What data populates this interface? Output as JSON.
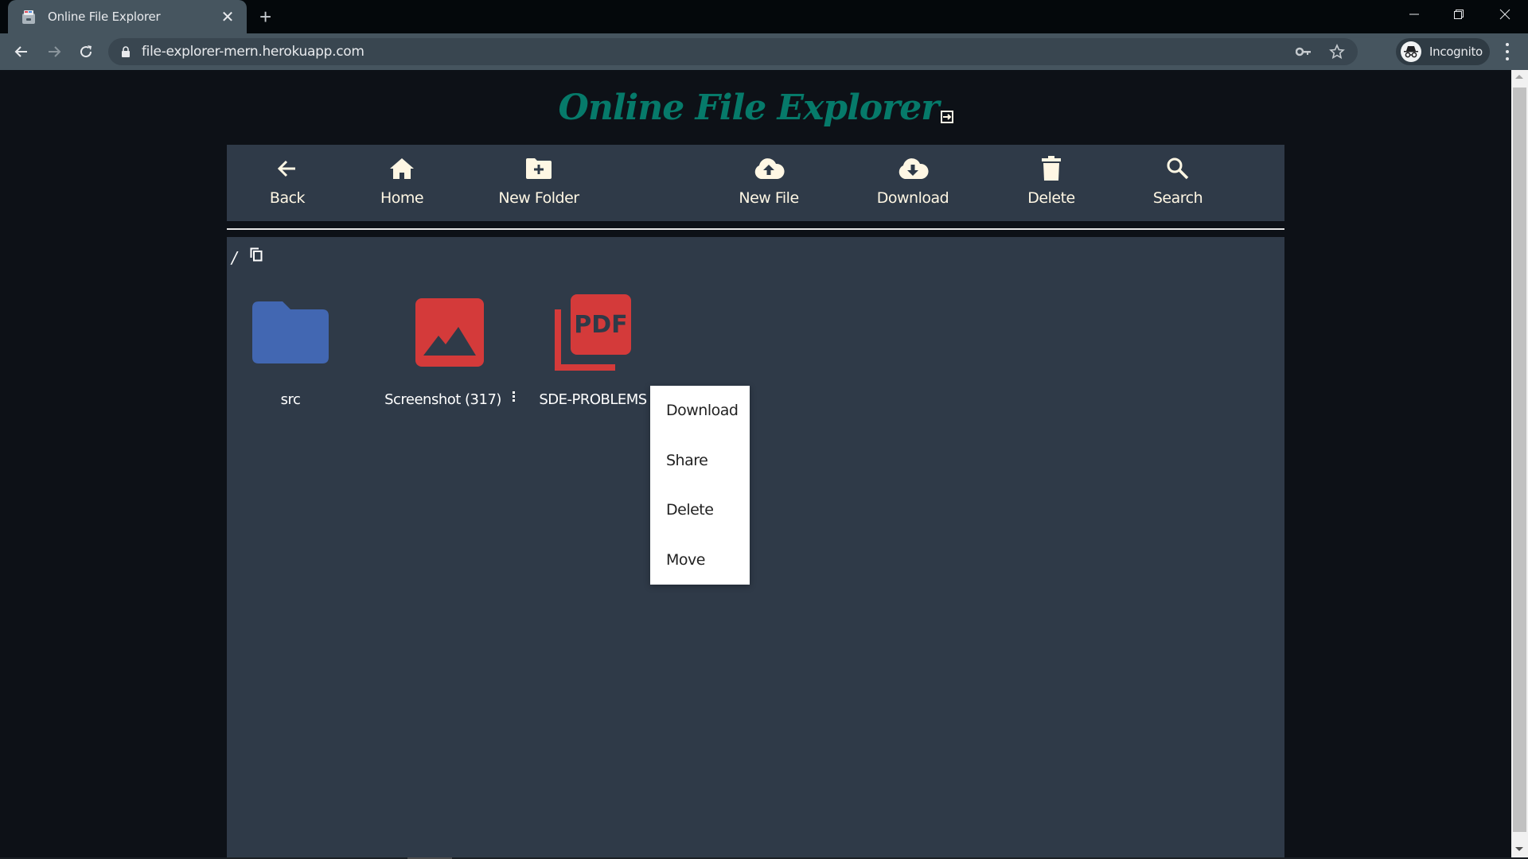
{
  "browser": {
    "tab_title": "Online File Explorer",
    "url": "file-explorer-mern.herokuapp.com",
    "incognito_label": "Incognito",
    "icons": {
      "favicon": "file-cabinet-icon",
      "close": "close-icon",
      "new_tab": "plus-icon",
      "back": "arrow-left-icon",
      "forward": "arrow-right-icon",
      "reload": "reload-icon",
      "lock": "lock-icon",
      "key": "key-icon",
      "star": "star-icon",
      "incognito": "incognito-icon",
      "menu": "kebab-menu-icon"
    }
  },
  "app": {
    "title": "Online File Explorer",
    "title_color": "#067a6a",
    "toolbar": [
      {
        "label": "Back",
        "icon": "arrow-left-icon"
      },
      {
        "label": "Home",
        "icon": "home-icon"
      },
      {
        "label": "New Folder",
        "icon": "folder-plus-icon"
      },
      {
        "label": "New File",
        "icon": "cloud-upload-icon"
      },
      {
        "label": "Download",
        "icon": "cloud-download-icon"
      },
      {
        "label": "Delete",
        "icon": "trash-icon"
      },
      {
        "label": "Search",
        "icon": "search-icon"
      }
    ],
    "path": "/",
    "files": [
      {
        "name": "src",
        "type": "folder",
        "color": "#4267b2"
      },
      {
        "name": "Screenshot (317)",
        "type": "image",
        "color": "#d43a3a"
      },
      {
        "name": "SDE-PROBLEMS",
        "type": "pdf",
        "color": "#d43a3a"
      }
    ],
    "context_menu": {
      "target": "Screenshot (317)",
      "items": [
        "Download",
        "Share",
        "Delete",
        "Move"
      ]
    }
  }
}
